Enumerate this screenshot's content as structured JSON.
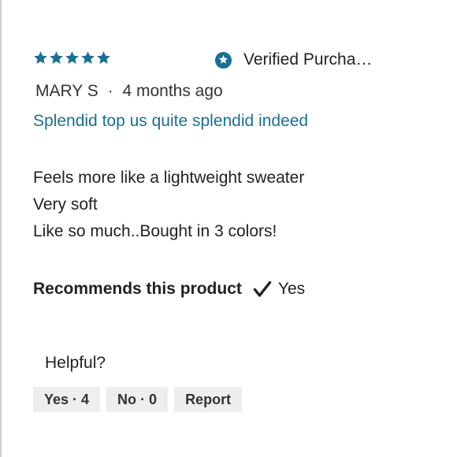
{
  "review": {
    "rating": 5,
    "rating_max": 5,
    "star_color": "#1a6f94",
    "verified_label": "Verified Purcha…",
    "author": "MARY S",
    "separator": "·",
    "age": "4 months ago",
    "title": "Splendid top us quite splendid indeed",
    "title_color": "#1a6f94",
    "body_lines": [
      "Feels more like a lightweight sweater",
      "Very soft",
      "Like so much..Bought in 3 colors!"
    ],
    "recommends_label": "Recommends this product",
    "recommends_icon": "check-icon",
    "recommends_value": "Yes"
  },
  "helpful": {
    "label": "Helpful?",
    "yes_label": "Yes · 4",
    "no_label": "No · 0",
    "report_label": "Report"
  }
}
